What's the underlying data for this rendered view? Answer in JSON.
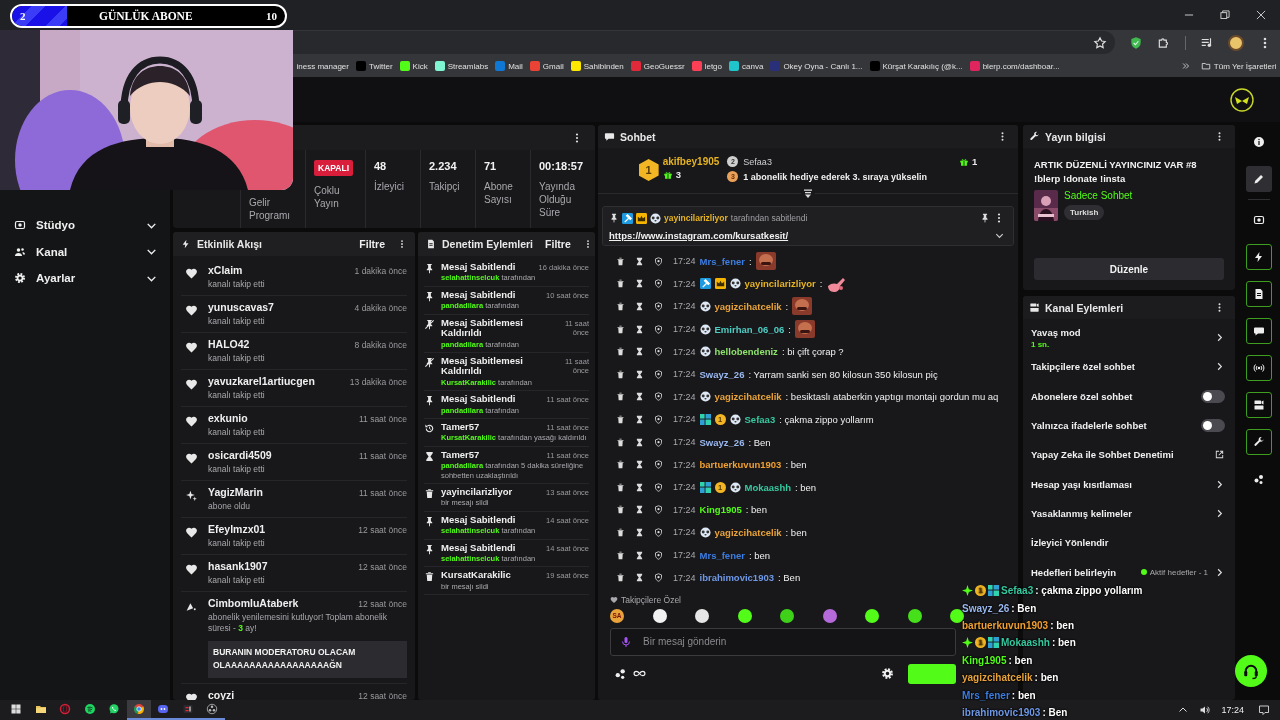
{
  "goal": {
    "current": "2",
    "title": "GÜNLÜK ABONE",
    "target": "10",
    "level": 0.2
  },
  "browser": {
    "bookmarks": [
      {
        "label": "iness manager"
      },
      {
        "label": "Twitter",
        "color": "#000000"
      },
      {
        "label": "Kick",
        "color": "#53fc18"
      },
      {
        "label": "Streamlabs",
        "color": "#80f5d2"
      },
      {
        "label": "Mail",
        "color": "#0f78d4"
      },
      {
        "label": "Gmail",
        "color": "#ea4335"
      },
      {
        "label": "Sahibinden",
        "color": "#ffe800"
      },
      {
        "label": "GeoGuessr",
        "color": "#e02a3a"
      },
      {
        "label": "letgo",
        "color": "#ff3f55"
      },
      {
        "label": "canva",
        "color": "#20c4cb"
      },
      {
        "label": "Okey Oyna - Canlı 1...",
        "color": "#2a2f7a"
      },
      {
        "label": "Kürşat Karakılıç (@k...",
        "color": "#000000"
      },
      {
        "label": "blerp.com/dashboar...",
        "color": "#e0245e"
      }
    ],
    "all_bookmarks": "Tüm Yer İşaretleri"
  },
  "sidebar": [
    {
      "kind": "studio",
      "label": "Stüdyo",
      "expanded": false
    },
    {
      "kind": "people",
      "label": "Kanal",
      "expanded": false
    },
    {
      "kind": "gear",
      "label": "Ayarlar",
      "expanded": false
    }
  ],
  "stats": {
    "cells": [
      {
        "label": "Gelir Programı"
      },
      {
        "status": "KAPALI",
        "label": "Çoklu Yayın"
      },
      {
        "value": "48",
        "label": "İzleyici"
      },
      {
        "value": "2.234",
        "label": "Takipçi"
      },
      {
        "value": "71",
        "label": "Abone Sayısı"
      },
      {
        "value": "00:18:57",
        "label": "Yayında Olduğu Süre"
      }
    ]
  },
  "activity_feed": {
    "title": "Etkinlik Akışı",
    "filter": "Filtre",
    "items": [
      {
        "kind": "follow",
        "name": "xClaim",
        "time": "1 dakika önce",
        "action": "kanalı takip etti"
      },
      {
        "kind": "follow",
        "name": "yunuscavas7",
        "time": "4 dakika önce",
        "action": "kanalı takip etti"
      },
      {
        "kind": "follow",
        "name": "HALO42",
        "time": "8 dakika önce",
        "action": "kanalı takip etti"
      },
      {
        "kind": "follow",
        "name": "yavuzkarel1artiucgen",
        "time": "13 dakika önce",
        "action": "kanalı takip etti"
      },
      {
        "kind": "follow",
        "name": "exkunio",
        "time": "11 saat önce",
        "action": "kanalı takip etti"
      },
      {
        "kind": "follow",
        "name": "osicardi4509",
        "time": "11 saat önce",
        "action": "kanalı takip etti"
      },
      {
        "kind": "sub",
        "name": "YagizMarin",
        "time": "11 saat önce",
        "action": "abone oldu"
      },
      {
        "kind": "follow",
        "name": "Efeylmzx01",
        "time": "12 saat önce",
        "action": "kanalı takip etti"
      },
      {
        "kind": "follow",
        "name": "hasank1907",
        "time": "12 saat önce",
        "action": "kanalı takip etti"
      },
      {
        "kind": "resub",
        "name": "CimbomluAtaberk",
        "time": "12 saat önce",
        "action": "abonelik yenilemesini kutluyor! Toplam abonelik süresi - ",
        "months": "3",
        "suffix": " ay!",
        "message": "BURANIN MODERATORU OLACAM OLAAAAAAAAAAAAAAAAAĞN"
      },
      {
        "kind": "follow",
        "name": "coyzi",
        "time": "12 saat önce"
      }
    ]
  },
  "moderation": {
    "title": "Denetim Eylemleri",
    "filter": "Filtre",
    "items": [
      {
        "kind": "pin",
        "title": "Mesaj Sabitlendi",
        "time": "16 dakika önce",
        "actor": "selahattinselcuk",
        "rest": " tarafından"
      },
      {
        "kind": "pin",
        "title": "Mesaj Sabitlendi",
        "time": "10 saat önce",
        "actor": "pandadilara",
        "rest": " tarafından"
      },
      {
        "kind": "unpin",
        "title": "Mesaj Sabitlemesi Kaldırıldı",
        "time": "11 saat önce",
        "actor": "pandadilara",
        "rest": " tarafından"
      },
      {
        "kind": "unpin",
        "title": "Mesaj Sabitlemesi Kaldırıldı",
        "time": "11 saat önce",
        "actor": "KursatKarakilic",
        "rest": " tarafından"
      },
      {
        "kind": "pin",
        "title": "Mesaj Sabitlendi",
        "time": "11 saat önce",
        "actor": "pandadilara",
        "rest": " tarafından"
      },
      {
        "kind": "unban",
        "title": "Tamer57",
        "time": "11 saat önce",
        "actor": "KursatKarakilic",
        "rest": " tarafından yasağı kaldırıldı"
      },
      {
        "kind": "timeout",
        "title": "Tamer57",
        "time": "11 saat önce",
        "actor": "pandadilara",
        "rest": " tarafından 5 dakika süreliğine sohbetten uzaklaştırıldı"
      },
      {
        "kind": "delete",
        "title": "yayincilarizliyor",
        "time": "13 saat önce",
        "rest": "bir mesajı sildi"
      },
      {
        "kind": "pin",
        "title": "Mesaj Sabitlendi",
        "time": "14 saat önce",
        "actor": "selahattinselcuk",
        "rest": " tarafından"
      },
      {
        "kind": "pin",
        "title": "Mesaj Sabitlendi",
        "time": "14 saat önce",
        "actor": "selahattinselcuk",
        "rest": " tarafından"
      },
      {
        "kind": "delete",
        "title": "KursatKarakilic",
        "time": "19 saat önce",
        "rest": "bir mesajı sildi"
      }
    ]
  },
  "chat": {
    "title": "Sohbet",
    "leaders": [
      {
        "rank": "1",
        "name": "akifbey1905",
        "gifts": "3"
      },
      {
        "rank": "2",
        "name": "Sefaa3",
        "gifts": "1"
      }
    ],
    "next": {
      "rank": "3",
      "text": "1 abonelik hediye ederek 3. sıraya yükselin"
    },
    "pinned": {
      "badges": [
        {
          "kind": "mod"
        },
        {
          "kind": "crown"
        },
        {
          "kind": "panda"
        }
      ],
      "user": "yayincilarizliyor",
      "color": "#e6b422",
      "note": " tarafından sabitlendi",
      "link": "https://www.instagram.com/kursatkesit/"
    },
    "messages": [
      {
        "kind": "face",
        "time": "17:24",
        "user": "Mrs_fener",
        "color": "#3d7de0",
        "text": ":"
      },
      {
        "kind": "hand",
        "time": "17:24",
        "badges": [
          {
            "kind": "mod"
          },
          {
            "kind": "crown"
          },
          {
            "kind": "panda"
          }
        ],
        "user": "yayincilarizliyor",
        "color": "#e6b422",
        "text": ":"
      },
      {
        "kind": "face",
        "time": "17:24",
        "badges": [
          {
            "kind": "panda"
          }
        ],
        "user": "yagizcihatcelik",
        "color": "#e8a33a",
        "text": ":"
      },
      {
        "kind": "face",
        "time": "17:24",
        "badges": [
          {
            "kind": "panda"
          }
        ],
        "user": "Emirhan_06_06",
        "color": "#4ecdc4",
        "text": ":"
      },
      {
        "kind": "text",
        "time": "17:24",
        "badges": [
          {
            "kind": "panda"
          }
        ],
        "user": "hellobendeniz",
        "color": "#8fe36a",
        "text": ": bi çift çorap ?"
      },
      {
        "kind": "text",
        "time": "17:24",
        "user": "Swayz_26",
        "color": "#9ab8f0",
        "text": ": Yarram sanki sen 80 kilosun 350 kilosun piç"
      },
      {
        "kind": "text",
        "time": "17:24",
        "badges": [
          {
            "kind": "panda"
          }
        ],
        "user": "yagizcihatcelik",
        "color": "#e8a33a",
        "text": ": besiktaslı ataberkin yaptıgı montajı gordun mu aq"
      },
      {
        "kind": "text",
        "time": "17:24",
        "badges": [
          {
            "kind": "sub"
          },
          {
            "kind": "gifter",
            "label": "1"
          },
          {
            "kind": "panda"
          }
        ],
        "user": "Sefaa3",
        "color": "#36c9a0",
        "text": ": çakma zippo yollarım"
      },
      {
        "kind": "text",
        "time": "17:24",
        "user": "Swayz_26",
        "color": "#9ab8f0",
        "text": ": Ben"
      },
      {
        "kind": "text",
        "time": "17:24",
        "user": "bartuerkuvun1903",
        "color": "#f0a030",
        "text": ": ben"
      },
      {
        "kind": "text",
        "time": "17:24",
        "badges": [
          {
            "kind": "sub"
          },
          {
            "kind": "gifter",
            "label": "1"
          },
          {
            "kind": "panda"
          }
        ],
        "user": "Mokaashh",
        "color": "#36c9a0",
        "text": ": ben"
      },
      {
        "kind": "text",
        "time": "17:24",
        "user": "King1905",
        "color": "#53fc18",
        "text": ": ben"
      },
      {
        "kind": "text",
        "time": "17:24",
        "badges": [
          {
            "kind": "panda"
          }
        ],
        "user": "yagizcihatcelik",
        "color": "#e8a33a",
        "text": ": ben"
      },
      {
        "kind": "text",
        "time": "17:24",
        "user": "Mrs_fener",
        "color": "#3d7de0",
        "text": ": ben"
      },
      {
        "kind": "text",
        "time": "17:24",
        "user": "ibrahimovic1903",
        "color": "#6e98e6",
        "text": ": Ben"
      }
    ],
    "emote_label": "Takipçilere Özel",
    "emotes": [
      {
        "color": "#e8a33a",
        "label": "SA"
      },
      {
        "color": "#f2f2f2"
      },
      {
        "color": "#e6e6e6"
      },
      {
        "color": "#53fc18"
      },
      {
        "color": "#3fd11a"
      },
      {
        "color": "#b46ad8"
      },
      {
        "color": "#53fc18"
      },
      {
        "color": "#45e01a"
      },
      {
        "color": "#53fc18"
      }
    ],
    "placeholder": "Bir mesaj gönderin"
  },
  "channel_info": {
    "title": "Yayın bilgisi",
    "stream_title": "ARTIK DÜZENLİ YAYINCINIZ VAR #8 !blerp !donate !insta",
    "category": "Sadece Sohbet",
    "tag": "Turkish",
    "edit": "Düzenle"
  },
  "channel_actions": {
    "title": "Kanal Eylemleri",
    "items": [
      {
        "kind": "chevron",
        "label": "Yavaş mod",
        "detail": "1 sn."
      },
      {
        "kind": "chevron",
        "label": "Takipçilere özel sohbet"
      },
      {
        "kind": "toggle",
        "label": "Abonelere özel sohbet",
        "on": false
      },
      {
        "kind": "toggle",
        "label": "Yalnızca ifadelerle sohbet",
        "on": false
      },
      {
        "kind": "external",
        "label": "Yapay Zeka ile Sohbet Denetimi"
      },
      {
        "kind": "chevron",
        "label": "Hesap yaşı kısıtlaması"
      },
      {
        "kind": "chevron",
        "label": "Yasaklanmış kelimeler"
      },
      {
        "kind": "plain",
        "label": "İzleyici Yönlendir"
      },
      {
        "kind": "chevron",
        "label": "Hedefleri belirleyin",
        "status": "Aktif hedefler - 1"
      }
    ]
  },
  "rail": [
    {
      "kind": "info",
      "active": false,
      "selected": false
    },
    {
      "kind": "pencil",
      "active": false,
      "selected": true
    },
    {
      "kind": "studio",
      "active": false,
      "selected": false
    },
    {
      "kind": "bolt",
      "active": true,
      "selected": false
    },
    {
      "kind": "doc",
      "active": true,
      "selected": false
    },
    {
      "kind": "chat",
      "active": true,
      "selected": false
    },
    {
      "kind": "broadcast",
      "active": true,
      "selected": false
    },
    {
      "kind": "channel",
      "active": true,
      "selected": false
    },
    {
      "kind": "wrench",
      "active": true,
      "selected": false
    },
    {
      "kind": "dots",
      "active": false,
      "selected": false
    }
  ],
  "stream_chat_overlay": [
    {
      "badges": [
        {
          "kind": "plus"
        },
        {
          "kind": "gifter",
          "label": "1"
        },
        {
          "kind": "sub"
        }
      ],
      "user": "Sefaa3",
      "color": "#36c9a0",
      "text": " : çakma zippo yollarım"
    },
    {
      "user": "Swayz_26",
      "color": "#9ab8f0",
      "text": " : Ben"
    },
    {
      "user": "bartuerkuvun1903",
      "color": "#f0a030",
      "text": " : ben"
    },
    {
      "badges": [
        {
          "kind": "plus"
        },
        {
          "kind": "gifter",
          "label": "1"
        },
        {
          "kind": "sub"
        }
      ],
      "user": "Mokaashh",
      "color": "#36c9a0",
      "text": " : ben"
    },
    {
      "user": "King1905",
      "color": "#53fc18",
      "text": " : ben"
    },
    {
      "user": "yagizcihatcelik",
      "color": "#e8a33a",
      "text": " : ben"
    },
    {
      "user": "Mrs_fener",
      "color": "#3d7de0",
      "text": " : ben"
    },
    {
      "user": "ibrahimovic1903",
      "color": "#6e98e6",
      "text": " : Ben"
    }
  ],
  "taskbar": {
    "apps": [
      {
        "kind": "windows",
        "selected": false,
        "open": false
      },
      {
        "kind": "files",
        "selected": false,
        "open": false
      },
      {
        "kind": "opera",
        "selected": false,
        "open": false
      },
      {
        "kind": "spotify",
        "selected": false,
        "open": false
      },
      {
        "kind": "whatsapp",
        "selected": false,
        "open": false
      },
      {
        "kind": "chrome",
        "selected": true,
        "open": true
      },
      {
        "kind": "discord",
        "selected": false,
        "open": true
      },
      {
        "kind": "streamlabs",
        "selected": false,
        "open": true
      },
      {
        "kind": "obs",
        "selected": false,
        "open": true
      }
    ],
    "time": "17:24"
  }
}
